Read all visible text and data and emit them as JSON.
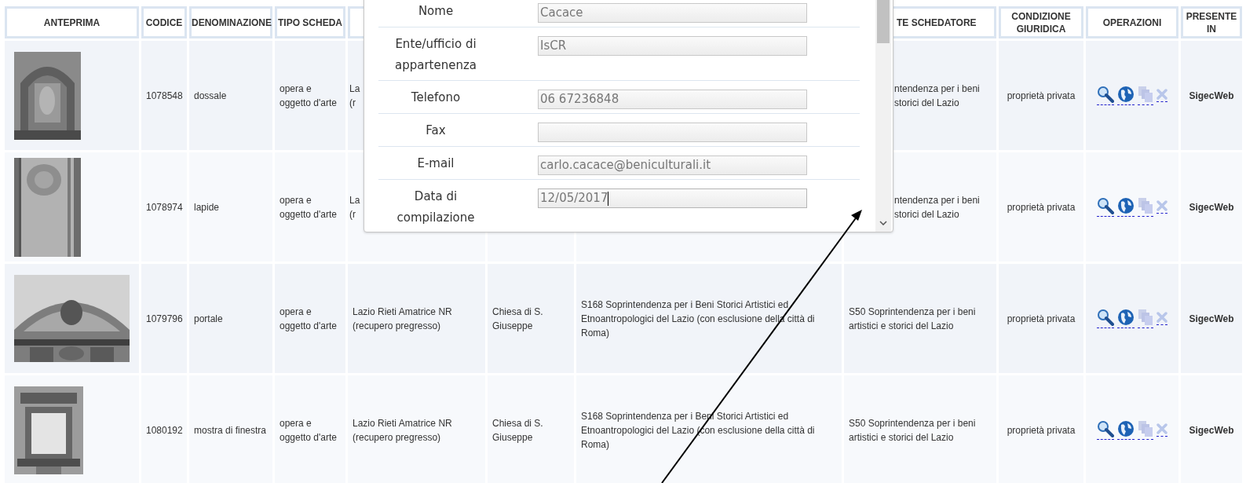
{
  "table": {
    "columns": [
      {
        "label": "ANTEPRIMA"
      },
      {
        "label": "CODICE"
      },
      {
        "label": "DENOMINAZIONE"
      },
      {
        "label": "TIPO SCHEDA"
      },
      {},
      {},
      {},
      {
        "label": "TE SCHEDATORE"
      },
      {
        "label": "CONDIZIONE GIURIDICA"
      },
      {
        "label": "OPERAZIONI"
      },
      {
        "label": "PRESENTE IN"
      }
    ],
    "rows": [
      {
        "codice": "1078548",
        "denominazione": "dossale",
        "tipo_scheda": "opera e oggetto d'arte",
        "column_5": {
          "text": "La\n(r"
        },
        "ente_schedatore": {
          "text": "ntendenza per i beni\nstorici del Lazio"
        },
        "condizione_giuridica": "proprietà privata",
        "operations": [
          {
            "kind": "search"
          },
          {
            "kind": "globe"
          },
          {
            "kind": "copy"
          },
          {
            "kind": "delete"
          }
        ],
        "presente_in": "SigecWeb"
      },
      {
        "codice": "1078974",
        "denominazione": "lapide",
        "tipo_scheda": "opera e oggetto d'arte",
        "column_5": {
          "text": "La\n(r"
        },
        "ente_schedatore": {
          "text": "ntendenza per i beni\nstorici del Lazio"
        },
        "condizione_giuridica": "proprietà privata",
        "operations": [
          {
            "kind": "search"
          },
          {
            "kind": "globe"
          },
          {
            "kind": "copy"
          },
          {
            "kind": "delete"
          }
        ],
        "presente_in": "SigecWeb"
      },
      {
        "codice": "1079796",
        "denominazione": "portale",
        "tipo_scheda": "opera e oggetto d'arte",
        "column_5": {
          "text": "Lazio Rieti Amatrice NR (recupero pregresso)"
        },
        "column_6": {
          "text": "Chiesa di S. Giuseppe"
        },
        "column_7": {
          "text": "S168 Soprintendenza per i Beni Storici Artistici ed Etnoantropologici del Lazio (con esclusione della città di Roma)"
        },
        "ente_schedatore": {
          "text": "S50 Soprintendenza per i beni artistici e storici del Lazio"
        },
        "condizione_giuridica": "proprietà privata",
        "operations": [
          {
            "kind": "search"
          },
          {
            "kind": "globe"
          },
          {
            "kind": "copy"
          },
          {
            "kind": "delete"
          }
        ],
        "presente_in": "SigecWeb"
      },
      {
        "codice": "1080192",
        "denominazione": "mostra di finestra",
        "tipo_scheda": "opera e oggetto d'arte",
        "column_5": {
          "text": "Lazio Rieti Amatrice NR (recupero pregresso)"
        },
        "column_6": {
          "text": "Chiesa di S. Giuseppe"
        },
        "column_7": {
          "text": "S168 Soprintendenza per i Beni Storici Artistici ed Etnoantropologici del Lazio (con esclusione della città di Roma)"
        },
        "ente_schedatore": {
          "text": "S50 Soprintendenza per i beni artistici e storici del Lazio"
        },
        "condizione_giuridica": "proprietà privata",
        "operations": [
          {
            "kind": "search"
          },
          {
            "kind": "globe"
          },
          {
            "kind": "copy"
          },
          {
            "kind": "delete"
          }
        ],
        "presente_in": "SigecWeb"
      }
    ]
  },
  "dialog": {
    "fields": [
      {
        "label": "Nome",
        "value": "Cacace",
        "focused": false
      },
      {
        "label": "Ente/ufficio di appartenenza",
        "value": "IsCR",
        "focused": false
      },
      {
        "label": "Telefono",
        "value": "06 67236848",
        "focused": false
      },
      {
        "label": "Fax",
        "focused": false
      },
      {
        "label": "E-mail",
        "value": "carlo.cacace@beniculturali.it",
        "focused": false
      },
      {
        "label": "Data di compilazione",
        "value": "12/05/2017",
        "focused": true
      }
    ]
  }
}
